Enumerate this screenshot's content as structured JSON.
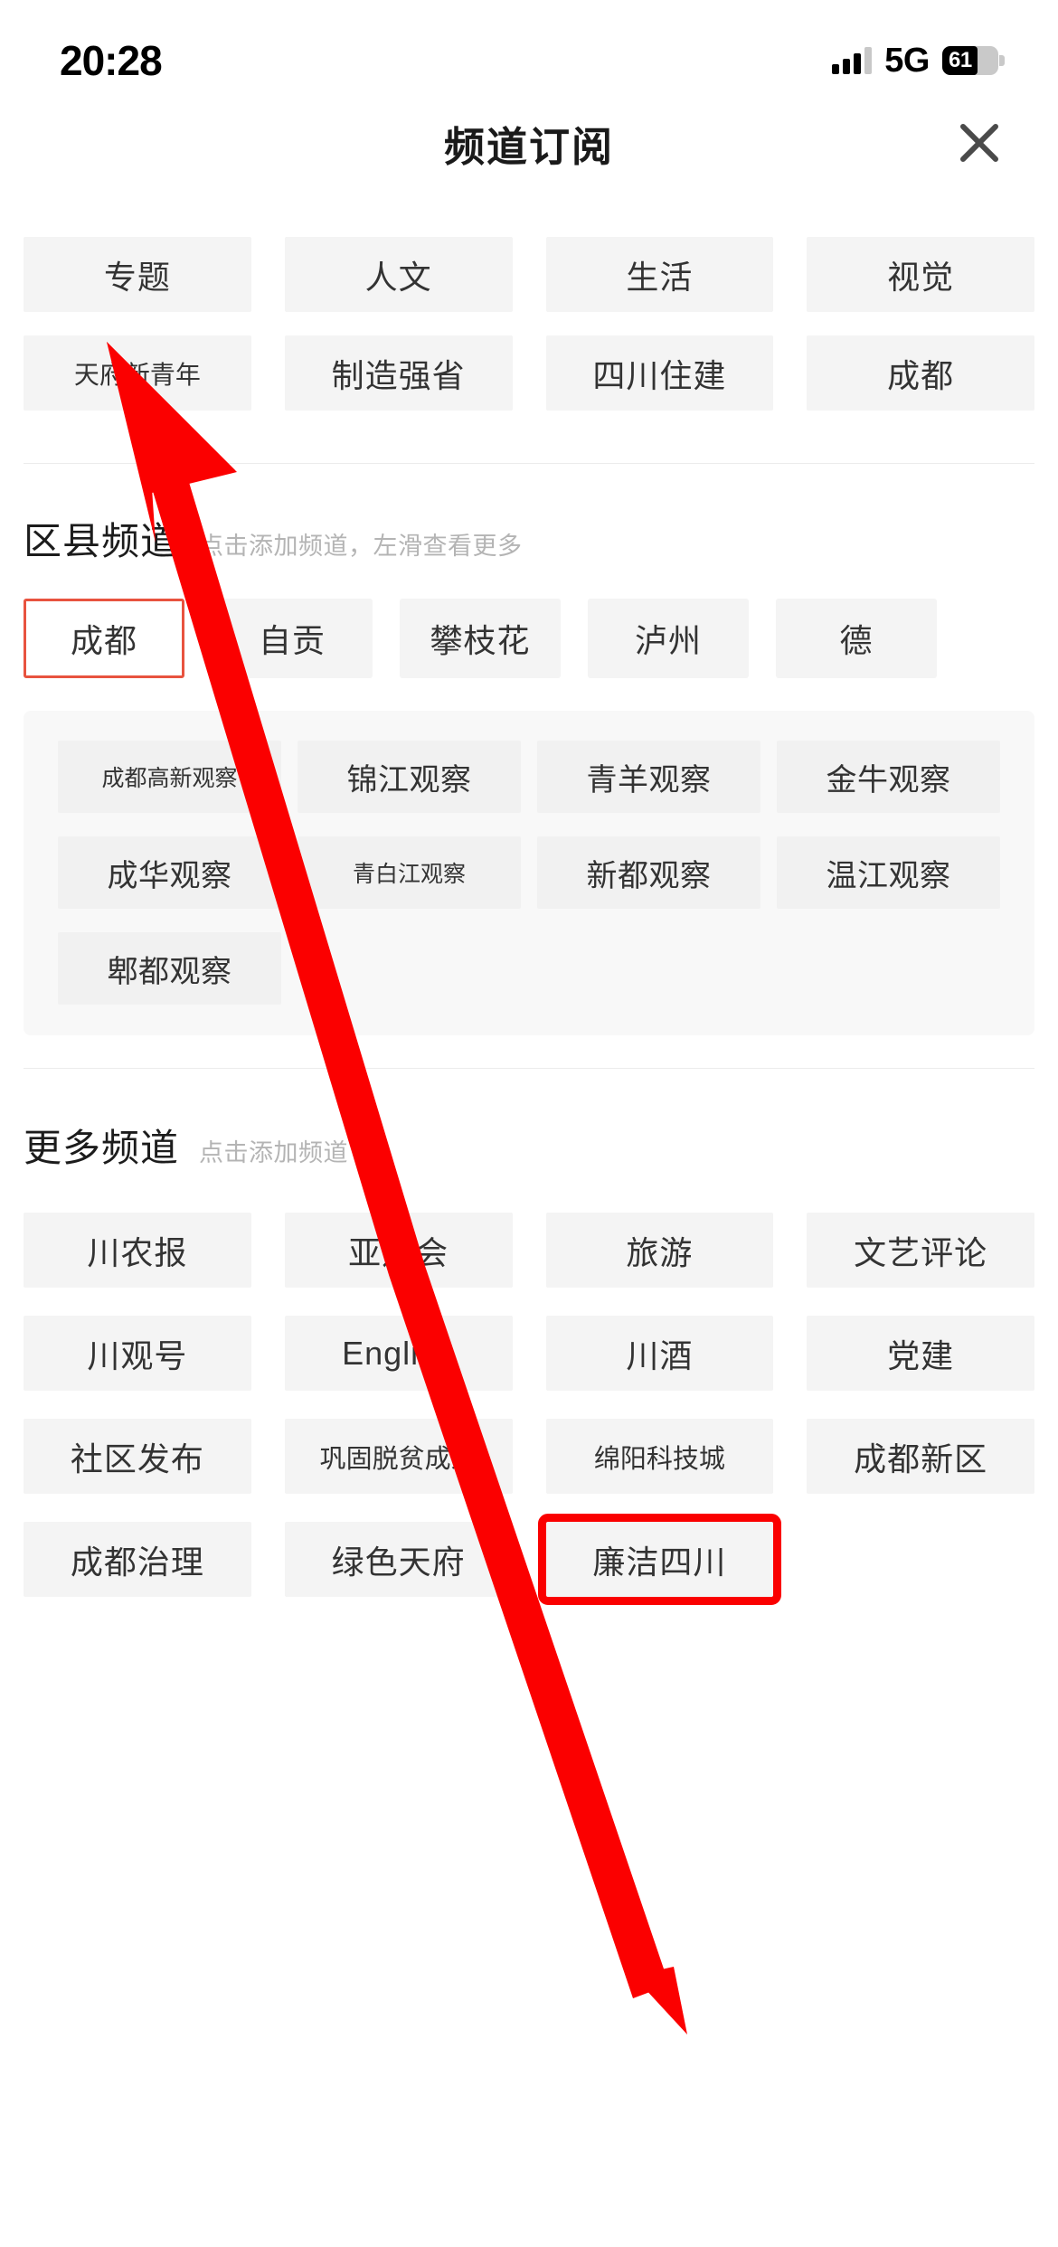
{
  "status_bar": {
    "time": "20:28",
    "network": "5G",
    "battery_percent": "61"
  },
  "header": {
    "title": "频道订阅",
    "close_icon": "close-icon"
  },
  "top_channels": {
    "row1": [
      "专题",
      "人文",
      "生活",
      "视觉"
    ],
    "row2": [
      "天府新青年",
      "制造强省",
      "四川住建",
      "成都"
    ]
  },
  "district_section": {
    "title": "区县频道",
    "hint": "点击添加频道，左滑查看更多",
    "cities": [
      {
        "label": "成都",
        "selected": true
      },
      {
        "label": "自贡",
        "selected": false
      },
      {
        "label": "攀枝花",
        "selected": false
      },
      {
        "label": "泸州",
        "selected": false
      },
      {
        "label": "德",
        "selected": false
      }
    ],
    "districts": [
      "成都高新观察",
      "锦江观察",
      "青羊观察",
      "金牛观察",
      "成华观察",
      "青白江观察",
      "新都观察",
      "温江观察",
      "郫都观察"
    ]
  },
  "more_section": {
    "title": "更多频道",
    "hint": "点击添加频道",
    "channels": [
      "川农报",
      "亚运会",
      "旅游",
      "文艺评论",
      "川观号",
      "English",
      "川酒",
      "党建",
      "社区发布",
      "巩固脱贫成果",
      "绵阳科技城",
      "成都新区",
      "成都治理",
      "绿色天府",
      "廉洁四川"
    ],
    "highlighted_channel": "廉洁四川"
  },
  "annotation": {
    "arrow_color": "#fb0000",
    "highlight_box_color": "#fa0000"
  }
}
